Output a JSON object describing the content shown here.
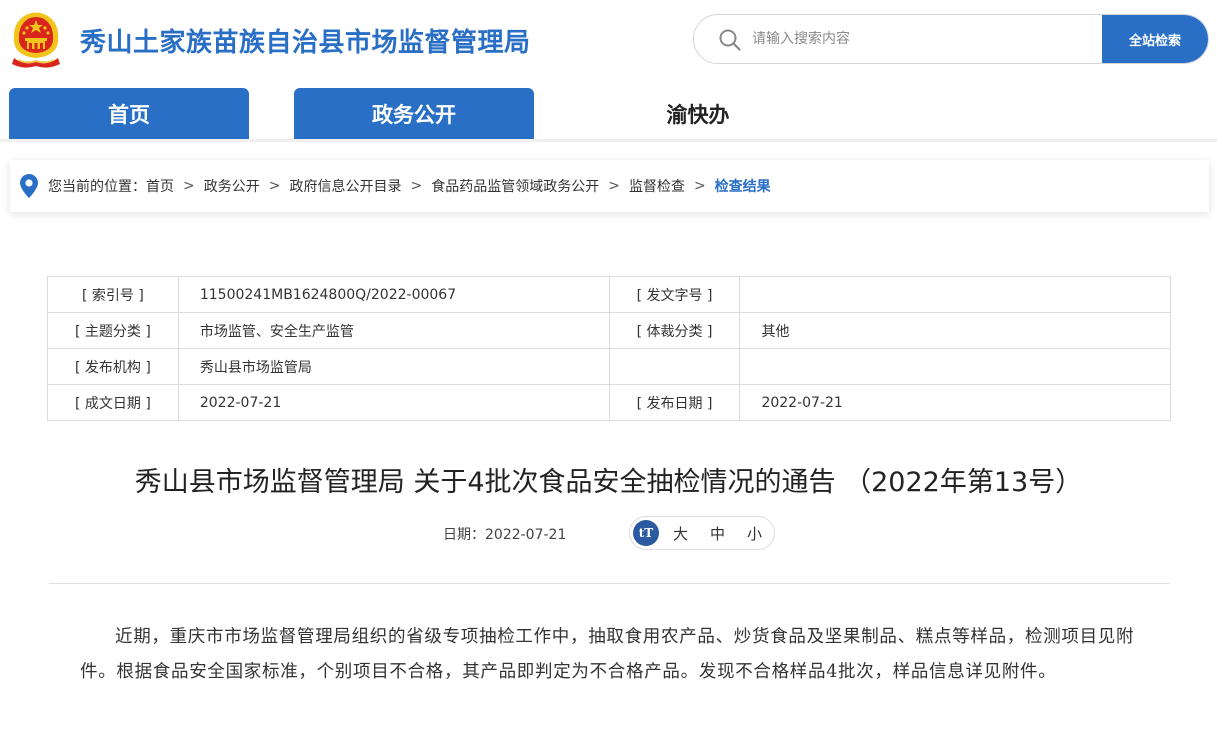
{
  "header": {
    "site_title": "秀山土家族苗族自治县市场监督管理局",
    "search_placeholder": "请输入搜索内容",
    "search_button": "全站检索"
  },
  "nav": {
    "tabs": [
      {
        "label": "首页",
        "active": true
      },
      {
        "label": "政务公开",
        "active": true
      },
      {
        "label": "渝快办",
        "active": false
      }
    ]
  },
  "breadcrumb": {
    "prefix": "您当前的位置：",
    "items": [
      "首页",
      "政务公开",
      "政府信息公开目录",
      "食品药品监管领域政务公开",
      "监督检查",
      "检查结果"
    ],
    "separator": ">"
  },
  "info": {
    "index_label": "[ 索引号 ]",
    "index_value": "11500241MB1624800Q/2022-00067",
    "docno_label": "[ 发文字号 ]",
    "docno_value": "",
    "topic_label": "[ 主题分类 ]",
    "topic_value": "市场监管、安全生产监管",
    "genre_label": "[ 体裁分类 ]",
    "genre_value": "其他",
    "org_label": "[ 发布机构 ]",
    "org_value": "秀山县市场监管局",
    "created_label": "[ 成文日期 ]",
    "created_value": "2022-07-21",
    "published_label": "[ 发布日期 ]",
    "published_value": "2022-07-21"
  },
  "article": {
    "title": "秀山县市场监督管理局 关于4批次食品安全抽检情况的通告 （2022年第13号）",
    "date_label": "日期：2022-07-21",
    "font_icon": "tT",
    "font_large": "大",
    "font_medium": "中",
    "font_small": "小",
    "body": "近期，重庆市市场监督管理局组织的省级专项抽检工作中，抽取食用农产品、炒货食品及坚果制品、糕点等样品，检测项目见附件。根据食品安全国家标准，个别项目不合格，其产品即判定为不合格产品。发现不合格样品4批次，样品信息详见附件。"
  },
  "colors": {
    "brand_blue": "#2a6fc6",
    "emblem_red": "#d8261c",
    "emblem_gold": "#f2c31b"
  }
}
